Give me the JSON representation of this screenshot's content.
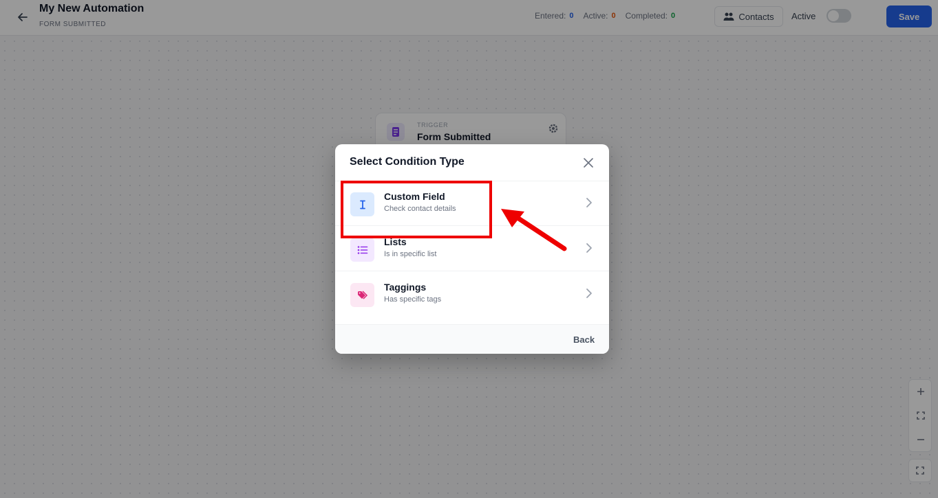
{
  "header": {
    "title": "My New Automation",
    "subtitle": "FORM SUBMITTED",
    "stats": [
      {
        "label": "Entered:",
        "value": "0",
        "color": "#2563eb"
      },
      {
        "label": "Active:",
        "value": "0",
        "color": "#ea580c"
      },
      {
        "label": "Completed:",
        "value": "0",
        "color": "#16a34a"
      }
    ],
    "contacts_label": "Contacts",
    "active_label": "Active",
    "active_toggle_on": false,
    "save_label": "Save"
  },
  "canvas": {
    "trigger": {
      "kicker": "TRIGGER",
      "name": "Form Submitted"
    },
    "zoom_controls": [
      "zoom-in-icon",
      "fit-view-icon",
      "zoom-out-icon"
    ],
    "fullscreen_icon": "fullscreen-icon"
  },
  "modal": {
    "title": "Select Condition Type",
    "options": [
      {
        "title": "Custom Field",
        "subtitle": "Check contact details",
        "icon": "text-cursor-icon",
        "icon_bg": "#dbeafe",
        "icon_color": "#2563eb"
      },
      {
        "title": "Lists",
        "subtitle": "Is in specific list",
        "icon": "list-icon",
        "icon_bg": "#f3e8ff",
        "icon_color": "#9333ea"
      },
      {
        "title": "Taggings",
        "subtitle": "Has specific tags",
        "icon": "tag-icon",
        "icon_bg": "#fce7f3",
        "icon_color": "#db2777"
      }
    ],
    "back_label": "Back"
  },
  "annotation": {
    "color": "#ee0000",
    "target": "Custom Field"
  }
}
